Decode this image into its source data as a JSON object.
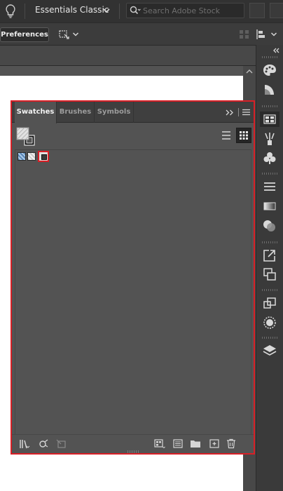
{
  "app_bar": {
    "workspace_label": "Essentials Classic",
    "search_placeholder": "Search Adobe Stock"
  },
  "control_bar": {
    "preferences_label": "Preferences"
  },
  "swatches_panel": {
    "tabs": [
      {
        "label": "Swatches",
        "active": true
      },
      {
        "label": "Brushes",
        "active": false
      },
      {
        "label": "Symbols",
        "active": false
      }
    ],
    "view_mode": "grid",
    "swatches": [
      {
        "name": "blue-pattern-swatch"
      },
      {
        "name": "gray-pattern-swatch"
      },
      {
        "name": "selected-pattern-swatch",
        "selected": true
      }
    ]
  },
  "colors": {
    "highlight_red": "#d81f26",
    "panel_bg": "#535353",
    "app_bar_bg": "#323232"
  },
  "icons": {
    "app_bar": [
      "lightbulb-icon",
      "chevron-down-icon",
      "search-icon"
    ],
    "control_bar": [
      "transform-icon",
      "chevron-down-icon",
      "align-icon",
      "distribute-icon"
    ],
    "dock": [
      "palette-icon",
      "gradient-swatch-icon",
      "swatches-icon",
      "brushes-icon",
      "symbols-icon",
      "stroke-icon",
      "gradient-icon",
      "transparency-icon",
      "export-icon",
      "arrange-icon",
      "transform-icon",
      "appearance-icon",
      "layers-icon"
    ],
    "footer": [
      "swatch-libraries-icon",
      "show-kinds-icon",
      "swatch-options-icon",
      "color-group-icon",
      "new-swatch-group-icon",
      "folder-icon",
      "new-swatch-icon",
      "trash-icon"
    ]
  }
}
